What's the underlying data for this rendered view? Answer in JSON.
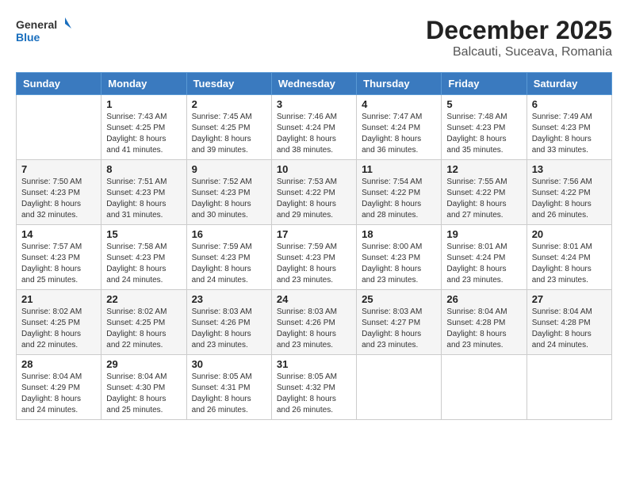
{
  "header": {
    "logo_general": "General",
    "logo_blue": "Blue",
    "title": "December 2025",
    "subtitle": "Balcauti, Suceava, Romania"
  },
  "weekdays": [
    "Sunday",
    "Monday",
    "Tuesday",
    "Wednesday",
    "Thursday",
    "Friday",
    "Saturday"
  ],
  "weeks": [
    [
      {
        "day": "",
        "sunrise": "",
        "sunset": "",
        "daylight": ""
      },
      {
        "day": "1",
        "sunrise": "Sunrise: 7:43 AM",
        "sunset": "Sunset: 4:25 PM",
        "daylight": "Daylight: 8 hours and 41 minutes."
      },
      {
        "day": "2",
        "sunrise": "Sunrise: 7:45 AM",
        "sunset": "Sunset: 4:25 PM",
        "daylight": "Daylight: 8 hours and 39 minutes."
      },
      {
        "day": "3",
        "sunrise": "Sunrise: 7:46 AM",
        "sunset": "Sunset: 4:24 PM",
        "daylight": "Daylight: 8 hours and 38 minutes."
      },
      {
        "day": "4",
        "sunrise": "Sunrise: 7:47 AM",
        "sunset": "Sunset: 4:24 PM",
        "daylight": "Daylight: 8 hours and 36 minutes."
      },
      {
        "day": "5",
        "sunrise": "Sunrise: 7:48 AM",
        "sunset": "Sunset: 4:23 PM",
        "daylight": "Daylight: 8 hours and 35 minutes."
      },
      {
        "day": "6",
        "sunrise": "Sunrise: 7:49 AM",
        "sunset": "Sunset: 4:23 PM",
        "daylight": "Daylight: 8 hours and 33 minutes."
      }
    ],
    [
      {
        "day": "7",
        "sunrise": "Sunrise: 7:50 AM",
        "sunset": "Sunset: 4:23 PM",
        "daylight": "Daylight: 8 hours and 32 minutes."
      },
      {
        "day": "8",
        "sunrise": "Sunrise: 7:51 AM",
        "sunset": "Sunset: 4:23 PM",
        "daylight": "Daylight: 8 hours and 31 minutes."
      },
      {
        "day": "9",
        "sunrise": "Sunrise: 7:52 AM",
        "sunset": "Sunset: 4:23 PM",
        "daylight": "Daylight: 8 hours and 30 minutes."
      },
      {
        "day": "10",
        "sunrise": "Sunrise: 7:53 AM",
        "sunset": "Sunset: 4:22 PM",
        "daylight": "Daylight: 8 hours and 29 minutes."
      },
      {
        "day": "11",
        "sunrise": "Sunrise: 7:54 AM",
        "sunset": "Sunset: 4:22 PM",
        "daylight": "Daylight: 8 hours and 28 minutes."
      },
      {
        "day": "12",
        "sunrise": "Sunrise: 7:55 AM",
        "sunset": "Sunset: 4:22 PM",
        "daylight": "Daylight: 8 hours and 27 minutes."
      },
      {
        "day": "13",
        "sunrise": "Sunrise: 7:56 AM",
        "sunset": "Sunset: 4:22 PM",
        "daylight": "Daylight: 8 hours and 26 minutes."
      }
    ],
    [
      {
        "day": "14",
        "sunrise": "Sunrise: 7:57 AM",
        "sunset": "Sunset: 4:23 PM",
        "daylight": "Daylight: 8 hours and 25 minutes."
      },
      {
        "day": "15",
        "sunrise": "Sunrise: 7:58 AM",
        "sunset": "Sunset: 4:23 PM",
        "daylight": "Daylight: 8 hours and 24 minutes."
      },
      {
        "day": "16",
        "sunrise": "Sunrise: 7:59 AM",
        "sunset": "Sunset: 4:23 PM",
        "daylight": "Daylight: 8 hours and 24 minutes."
      },
      {
        "day": "17",
        "sunrise": "Sunrise: 7:59 AM",
        "sunset": "Sunset: 4:23 PM",
        "daylight": "Daylight: 8 hours and 23 minutes."
      },
      {
        "day": "18",
        "sunrise": "Sunrise: 8:00 AM",
        "sunset": "Sunset: 4:23 PM",
        "daylight": "Daylight: 8 hours and 23 minutes."
      },
      {
        "day": "19",
        "sunrise": "Sunrise: 8:01 AM",
        "sunset": "Sunset: 4:24 PM",
        "daylight": "Daylight: 8 hours and 23 minutes."
      },
      {
        "day": "20",
        "sunrise": "Sunrise: 8:01 AM",
        "sunset": "Sunset: 4:24 PM",
        "daylight": "Daylight: 8 hours and 23 minutes."
      }
    ],
    [
      {
        "day": "21",
        "sunrise": "Sunrise: 8:02 AM",
        "sunset": "Sunset: 4:25 PM",
        "daylight": "Daylight: 8 hours and 22 minutes."
      },
      {
        "day": "22",
        "sunrise": "Sunrise: 8:02 AM",
        "sunset": "Sunset: 4:25 PM",
        "daylight": "Daylight: 8 hours and 22 minutes."
      },
      {
        "day": "23",
        "sunrise": "Sunrise: 8:03 AM",
        "sunset": "Sunset: 4:26 PM",
        "daylight": "Daylight: 8 hours and 23 minutes."
      },
      {
        "day": "24",
        "sunrise": "Sunrise: 8:03 AM",
        "sunset": "Sunset: 4:26 PM",
        "daylight": "Daylight: 8 hours and 23 minutes."
      },
      {
        "day": "25",
        "sunrise": "Sunrise: 8:03 AM",
        "sunset": "Sunset: 4:27 PM",
        "daylight": "Daylight: 8 hours and 23 minutes."
      },
      {
        "day": "26",
        "sunrise": "Sunrise: 8:04 AM",
        "sunset": "Sunset: 4:28 PM",
        "daylight": "Daylight: 8 hours and 23 minutes."
      },
      {
        "day": "27",
        "sunrise": "Sunrise: 8:04 AM",
        "sunset": "Sunset: 4:28 PM",
        "daylight": "Daylight: 8 hours and 24 minutes."
      }
    ],
    [
      {
        "day": "28",
        "sunrise": "Sunrise: 8:04 AM",
        "sunset": "Sunset: 4:29 PM",
        "daylight": "Daylight: 8 hours and 24 minutes."
      },
      {
        "day": "29",
        "sunrise": "Sunrise: 8:04 AM",
        "sunset": "Sunset: 4:30 PM",
        "daylight": "Daylight: 8 hours and 25 minutes."
      },
      {
        "day": "30",
        "sunrise": "Sunrise: 8:05 AM",
        "sunset": "Sunset: 4:31 PM",
        "daylight": "Daylight: 8 hours and 26 minutes."
      },
      {
        "day": "31",
        "sunrise": "Sunrise: 8:05 AM",
        "sunset": "Sunset: 4:32 PM",
        "daylight": "Daylight: 8 hours and 26 minutes."
      },
      {
        "day": "",
        "sunrise": "",
        "sunset": "",
        "daylight": ""
      },
      {
        "day": "",
        "sunrise": "",
        "sunset": "",
        "daylight": ""
      },
      {
        "day": "",
        "sunrise": "",
        "sunset": "",
        "daylight": ""
      }
    ]
  ]
}
